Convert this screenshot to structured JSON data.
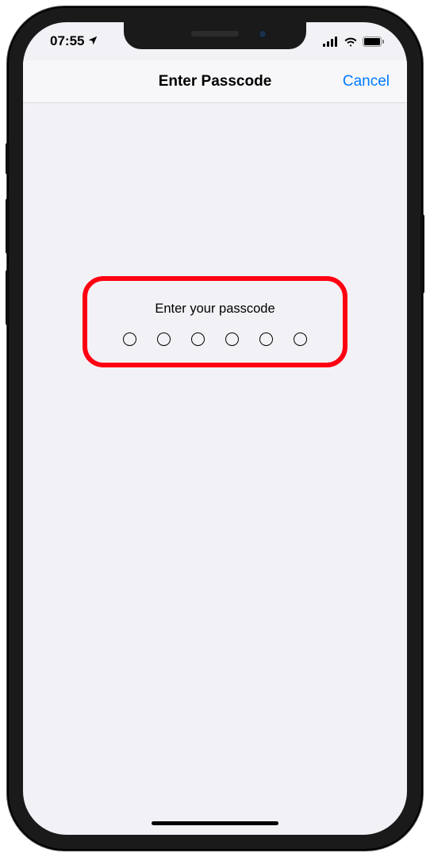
{
  "status_bar": {
    "time": "07:55"
  },
  "nav": {
    "title": "Enter Passcode",
    "cancel_label": "Cancel"
  },
  "passcode": {
    "prompt": "Enter your passcode",
    "digits_count": 6,
    "entered_count": 0
  },
  "annotation": {
    "highlight_color": "#ff0012"
  }
}
